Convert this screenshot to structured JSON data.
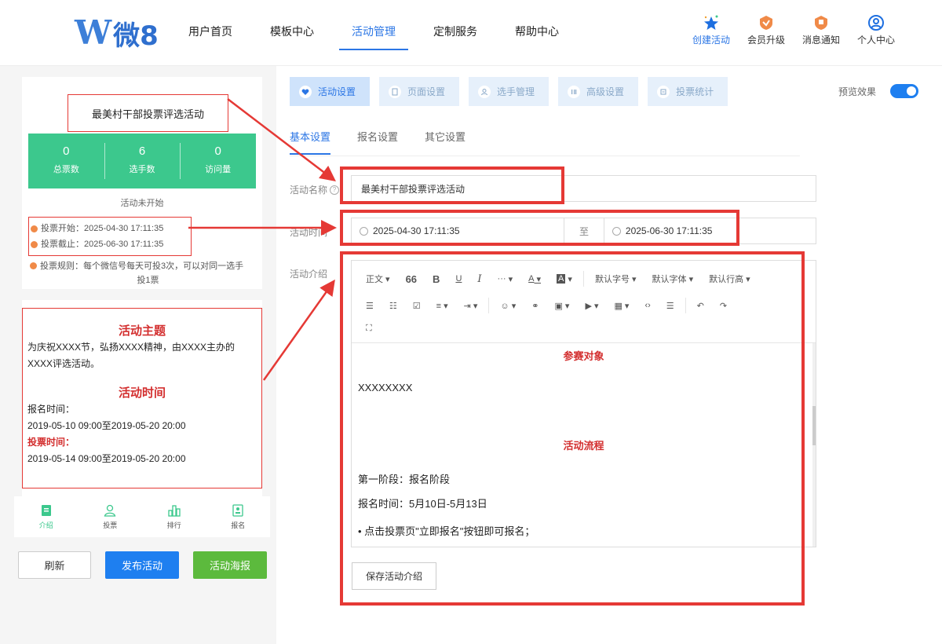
{
  "header": {
    "logo_text": "微8",
    "nav": [
      "用户首页",
      "模板中心",
      "活动管理",
      "定制服务",
      "帮助中心"
    ],
    "actions": [
      {
        "label": "创建活动",
        "icon": "sparkle-star-icon"
      },
      {
        "label": "会员升级",
        "icon": "member-badge-icon"
      },
      {
        "label": "消息通知",
        "icon": "notification-badge-icon"
      },
      {
        "label": "个人中心",
        "icon": "user-circle-icon"
      }
    ]
  },
  "preview": {
    "title": "最美村干部投票评选活动",
    "stats": [
      {
        "value": "0",
        "label": "总票数"
      },
      {
        "value": "6",
        "label": "选手数"
      },
      {
        "value": "0",
        "label": "访问量"
      }
    ],
    "status": "活动未开始",
    "vote_start": "投票开始：2025-04-30 17:11:35",
    "vote_end": "投票截止：2025-06-30 17:11:35",
    "vote_rule_1": "投票规则：每个微信号每天可投3次，可以对同一选手",
    "vote_rule_2": "投1票",
    "desc": {
      "h1": "活动主题",
      "p1": "为庆祝XXXX节，弘扬XXXX精神，由XXXX主办的XXXX评选活动。",
      "h2": "活动时间",
      "signup_label": "报名时间：",
      "signup_time": "2019-05-10 09:00至2019-05-20 20:00",
      "vote_label": "投票时间：",
      "vote_time": "2019-05-14 09:00至2019-05-20 20:00"
    },
    "tabbar": [
      "介绍",
      "投票",
      "排行",
      "报名"
    ],
    "buttons": {
      "refresh": "刷新",
      "publish": "发布活动",
      "poster": "活动海报"
    }
  },
  "steps": [
    "活动设置",
    "页面设置",
    "选手管理",
    "高级设置",
    "投票统计"
  ],
  "preview_toggle_label": "预览效果",
  "subtabs": [
    "基本设置",
    "报名设置",
    "其它设置"
  ],
  "form": {
    "name_label": "活动名称",
    "name_value": "最美村干部投票评选活动",
    "time_label": "活动时间",
    "start_time": "2025-04-30 17:11:35",
    "separator": "至",
    "end_time": "2025-06-30 17:11:35",
    "intro_label": "活动介绍",
    "toolbar_row1": [
      "正文",
      "66",
      "B",
      "U",
      "I",
      "···",
      "A",
      "A",
      "默认字号",
      "默认字体",
      "默认行高"
    ],
    "editor": {
      "h1": "参赛对象",
      "p1": "XXXXXXXX",
      "h2": "活动流程",
      "p2": "第一阶段：报名阶段",
      "p3": "报名时间：5月10日-5月13日",
      "p4": "• 点击投票页\"立即报名\"按钮即可报名；"
    },
    "save_label": "保存活动介绍"
  },
  "colors": {
    "accent": "#2b76e5",
    "green": "#3cc88d",
    "annotation": "#e53935"
  }
}
